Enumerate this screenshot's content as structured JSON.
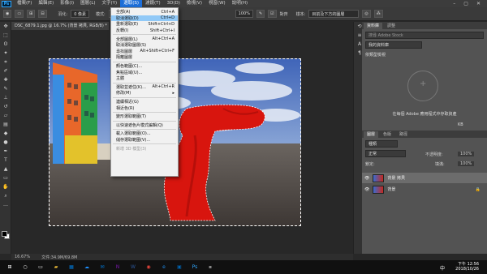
{
  "menubar": {
    "logo": "Ps",
    "items": [
      "檔案(F)",
      "編輯(E)",
      "影像(I)",
      "圖層(L)",
      "文字(Y)",
      "選取(S)",
      "濾鏡(T)",
      "3D(D)",
      "檢視(V)",
      "視窗(W)",
      "說明(H)"
    ],
    "active_index": 5,
    "window_controls": [
      "–",
      "▢",
      "✕"
    ]
  },
  "optbar": {
    "feather_label": "羽化:",
    "feather_value": "0 像素",
    "style_label": "模式:",
    "style_value": "正常",
    "zoom_value": "100%",
    "sample_label": "樣本:",
    "sample_value": "目前及下方的圖層",
    "antialias_label": "對齊"
  },
  "doc": {
    "tab_title": "DSC_6879.1.jpg @ 16.7% (背景 拷貝, RGB/8) *"
  },
  "select_menu": {
    "items": [
      {
        "label": "全部(A)",
        "shortcut": "Ctrl+A",
        "state": "normal"
      },
      {
        "label": "取消選取(D)",
        "shortcut": "Ctrl+D",
        "state": "highlight"
      },
      {
        "label": "重新選取(E)",
        "shortcut": "Shift+Ctrl+D",
        "state": "normal"
      },
      {
        "label": "反轉(I)",
        "shortcut": "Shift+Ctrl+I",
        "state": "normal"
      },
      {
        "sep": true
      },
      {
        "label": "全部圖層(L)",
        "shortcut": "Alt+Ctrl+A",
        "state": "normal"
      },
      {
        "label": "取消選取圖層(S)",
        "shortcut": "",
        "state": "normal"
      },
      {
        "label": "尋找圖層",
        "shortcut": "Alt+Shift+Ctrl+F",
        "state": "normal"
      },
      {
        "label": "隔離圖層",
        "shortcut": "",
        "state": "normal"
      },
      {
        "sep": true
      },
      {
        "label": "顏色範圍(C)...",
        "shortcut": "",
        "state": "normal"
      },
      {
        "label": "焦點區域(U)...",
        "shortcut": "",
        "state": "normal"
      },
      {
        "label": "主體",
        "shortcut": "",
        "state": "normal"
      },
      {
        "sep": true
      },
      {
        "label": "選取並遮住(K)...",
        "shortcut": "Alt+Ctrl+R",
        "state": "normal"
      },
      {
        "label": "修改(M)",
        "shortcut": "▸",
        "state": "normal"
      },
      {
        "sep": true
      },
      {
        "label": "連續相近(G)",
        "shortcut": "",
        "state": "normal"
      },
      {
        "label": "相近色(R)",
        "shortcut": "",
        "state": "normal"
      },
      {
        "sep": true
      },
      {
        "label": "變形選取範圍(T)",
        "shortcut": "",
        "state": "normal"
      },
      {
        "sep": true
      },
      {
        "label": "以快速遮色片模式編輯(Q)",
        "shortcut": "",
        "state": "normal"
      },
      {
        "sep": true
      },
      {
        "label": "載入選取範圍(O)...",
        "shortcut": "",
        "state": "normal"
      },
      {
        "label": "儲存選取範圍(V)...",
        "shortcut": "",
        "state": "normal"
      },
      {
        "sep": true
      },
      {
        "label": "新增 3D 模型(3)",
        "shortcut": "",
        "state": "disabled"
      }
    ]
  },
  "statusbar": {
    "zoom": "16.67%",
    "doc_size": "文件:34.9M/69.8M"
  },
  "libraries": {
    "tabs": [
      "資料庫",
      "調整"
    ],
    "search_placeholder": "搜尋 Adobe Stock",
    "library_select": "我的資料庫",
    "view_label": "依類型檢視",
    "empty_message": "在每個 Adobe 應用程式中存取資產",
    "size": "KB"
  },
  "layers": {
    "tabs": [
      "圖層",
      "色版",
      "路徑"
    ],
    "kind_label": "種類",
    "blend_mode": "正常",
    "opacity_label": "不透明度:",
    "opacity_value": "100%",
    "lock_label": "鎖定:",
    "fill_label": "填滿:",
    "fill_value": "100%",
    "items": [
      {
        "name": "背景 拷貝",
        "selected": true
      },
      {
        "name": "背景",
        "selected": false
      }
    ]
  },
  "taskbar": {
    "icons": [
      "start-icon",
      "search-icon",
      "taskview-icon",
      "explorer-icon",
      "store-icon",
      "onedrive-icon",
      "mail-icon",
      "onenote-icon",
      "word-icon",
      "chrome-icon",
      "edge-icon",
      "photos-icon",
      "photoshop-icon",
      "app-icon"
    ],
    "tray_lang": "中",
    "time": "下午 12:56",
    "date": "2018/10/26"
  }
}
